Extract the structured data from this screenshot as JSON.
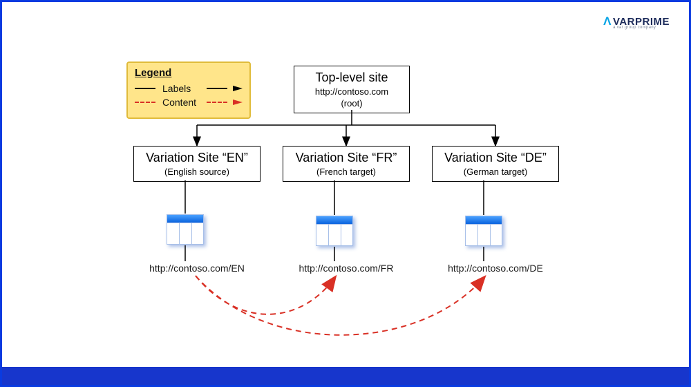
{
  "brand": {
    "name": "VARPRIME",
    "tagline": "a var group company"
  },
  "legend": {
    "title": "Legend",
    "labels_text": "Labels",
    "content_text": "Content"
  },
  "root": {
    "title": "Top-level site",
    "url": "http://contoso.com",
    "note": "(root)"
  },
  "sites": {
    "en": {
      "title": "Variation Site “EN”",
      "sub": "(English source)",
      "url": "http://contoso.com/EN"
    },
    "fr": {
      "title": "Variation Site “FR”",
      "sub": "(French target)",
      "url": "http://contoso.com/FR"
    },
    "de": {
      "title": "Variation Site “DE”",
      "sub": "(German target)",
      "url": "http://contoso.com/DE"
    }
  },
  "arrows": {
    "labels_color": "#000000",
    "content_color": "#d93025"
  }
}
